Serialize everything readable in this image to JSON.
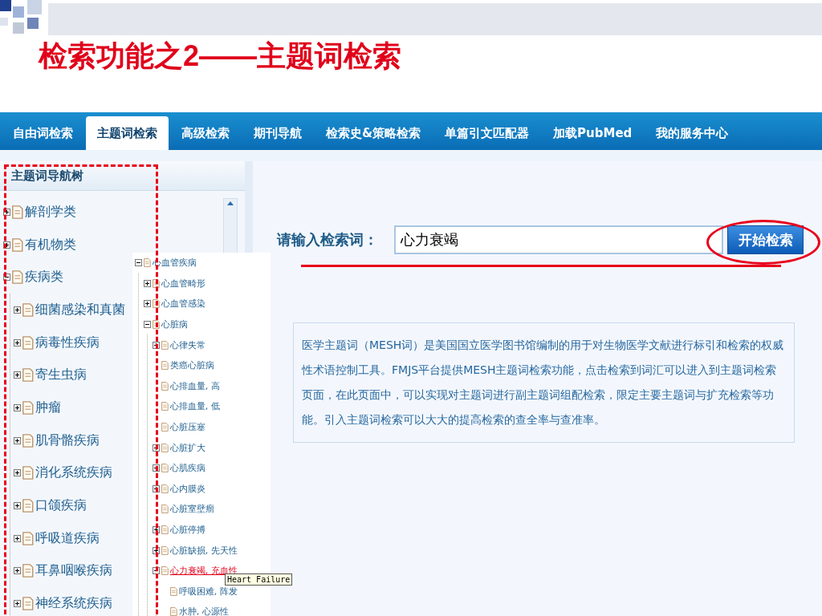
{
  "slide": {
    "title": "检索功能之2——主题词检索"
  },
  "nav": {
    "tabs": [
      {
        "label": "自由词检索",
        "selected": false
      },
      {
        "label": "主题词检索",
        "selected": true
      },
      {
        "label": "高级检索",
        "selected": false
      },
      {
        "label": "期刊导航",
        "selected": false
      },
      {
        "label": "检索史&策略检索",
        "selected": false
      },
      {
        "label": "单篇引文匹配器",
        "selected": false
      },
      {
        "label": "加载PubMed",
        "selected": false
      },
      {
        "label": "我的服务中心",
        "selected": false
      }
    ]
  },
  "tree_panel": {
    "title": "主题词导航树",
    "nodes": [
      {
        "label": "解剖学类",
        "expanded": false,
        "selected": false
      },
      {
        "label": "有机物类",
        "expanded": false,
        "selected": false
      },
      {
        "label": "疾病类",
        "expanded": true,
        "selected": false,
        "children": [
          {
            "label": "细菌感染和真菌",
            "expanded": false,
            "selected": false
          },
          {
            "label": "病毒性疾病",
            "expanded": false,
            "selected": false
          },
          {
            "label": "寄生虫病",
            "expanded": false,
            "selected": false
          },
          {
            "label": "肿瘤",
            "expanded": false,
            "selected": false
          },
          {
            "label": "肌骨骼疾病",
            "expanded": false,
            "selected": false
          },
          {
            "label": "消化系统疾病",
            "expanded": false,
            "selected": false
          },
          {
            "label": "口颌疾病",
            "expanded": false,
            "selected": false
          },
          {
            "label": "呼吸道疾病",
            "expanded": false,
            "selected": false
          },
          {
            "label": "耳鼻咽喉疾病",
            "expanded": false,
            "selected": false
          },
          {
            "label": "神经系统疾病",
            "expanded": false,
            "selected": false
          }
        ]
      }
    ]
  },
  "popup_tree": {
    "nodes": [
      {
        "label": "心血管疾病",
        "expanded": true,
        "selected": false,
        "children": [
          {
            "label": "心血管畸形",
            "expanded": false,
            "selected": false
          },
          {
            "label": "心血管感染",
            "expanded": false,
            "selected": false
          },
          {
            "label": "心脏病",
            "expanded": true,
            "selected": false,
            "children": [
              {
                "label": "心律失常",
                "expanded": false,
                "selected": false
              },
              {
                "label": "类癌心脏病",
                "selected": false
              },
              {
                "label": "心排血量, 高",
                "selected": false
              },
              {
                "label": "心排血量, 低",
                "selected": false
              },
              {
                "label": "心脏压塞",
                "selected": false
              },
              {
                "label": "心脏扩大",
                "expanded": false,
                "selected": false
              },
              {
                "label": "心肌疾病",
                "expanded": false,
                "selected": false
              },
              {
                "label": "心内膜炎",
                "expanded": false,
                "selected": false
              },
              {
                "label": "心脏室壁瘤",
                "selected": false
              },
              {
                "label": "心脏停搏",
                "expanded": false,
                "selected": false
              },
              {
                "label": "心脏缺损, 先天性",
                "expanded": false,
                "selected": false
              },
              {
                "label": "心力衰竭, 充血性",
                "expanded": true,
                "selected": true,
                "children": [
                  {
                    "label": "呼吸困难, 阵发",
                    "selected": false
                  },
                  {
                    "label": "水肿, 心源性",
                    "selected": false
                  }
                ]
              }
            ]
          }
        ]
      }
    ],
    "tooltip": "Heart Failure"
  },
  "search": {
    "label": "请输入检索词：",
    "value": "心力衰竭",
    "button": "开始检索"
  },
  "info": "医学主题词（MESH词）是美国国立医学图书馆编制的用于对生物医学文献进行标引和检索的权威性术语控制工具。FMJS平台提供MESH主题词检索功能，点击检索到词汇可以进入到主题词检索页面，在此页面中，可以实现对主题词进行副主题词组配检索，限定主要主题词与扩充检索等功能。引入主题词检索可以大大的提高检索的查全率与查准率。"
}
